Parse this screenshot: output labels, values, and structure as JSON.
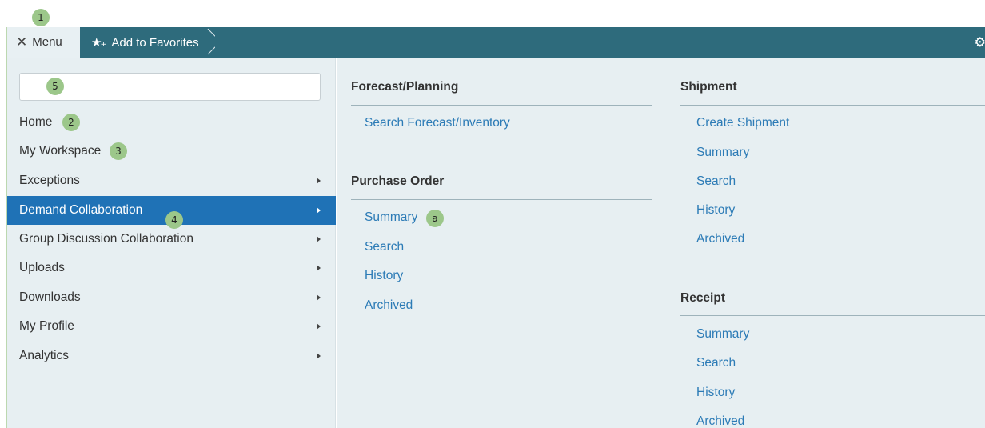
{
  "callouts": {
    "c1": "1",
    "c2": "2",
    "c3": "3",
    "c4": "4",
    "c5": "5",
    "ca": "a"
  },
  "topbar": {
    "menu_icon": "close-icon",
    "menu_label": "Menu",
    "favorites_icon": "star-plus-icon",
    "favorites_label": "Add to Favorites",
    "settings_icon": "gear-icon",
    "bar_color": "#2e6b7c"
  },
  "search": {
    "value": "",
    "placeholder": ""
  },
  "sidebar": {
    "items": [
      {
        "label": "Home",
        "has_submenu": false
      },
      {
        "label": "My Workspace",
        "has_submenu": false
      },
      {
        "label": "Exceptions",
        "has_submenu": true
      },
      {
        "label": "Demand Collaboration",
        "has_submenu": true,
        "selected": true
      },
      {
        "label": "Group Discussion Collaboration",
        "has_submenu": true
      },
      {
        "label": "Uploads",
        "has_submenu": true
      },
      {
        "label": "Downloads",
        "has_submenu": true
      },
      {
        "label": "My Profile",
        "has_submenu": true
      },
      {
        "label": "Analytics",
        "has_submenu": true
      }
    ],
    "selected_color": "#1f72b6"
  },
  "submenu": {
    "forecast": {
      "title": "Forecast/Planning",
      "links": [
        "Search Forecast/Inventory"
      ]
    },
    "purchase_order": {
      "title": "Purchase Order",
      "links": [
        "Summary",
        "Search",
        "History",
        "Archived"
      ]
    },
    "shipment": {
      "title": "Shipment",
      "links": [
        "Create Shipment",
        "Summary",
        "Search",
        "History",
        "Archived"
      ]
    },
    "receipt": {
      "title": "Receipt",
      "links": [
        "Summary",
        "Search",
        "History",
        "Archived"
      ]
    },
    "link_color": "#2c7bb6"
  }
}
